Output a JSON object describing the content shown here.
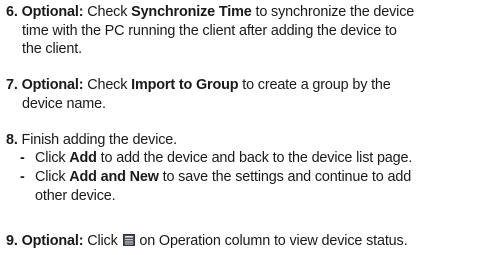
{
  "steps": [
    {
      "number": "6.",
      "prefix": "Optional:",
      "text_a": " Check ",
      "bold": "Synchronize Time",
      "text_b": " to synchronize the device",
      "line2": "time with the PC running the client after adding the device to",
      "line3": "the client."
    },
    {
      "number": "7.",
      "prefix": "Optional:",
      "text_a": " Check ",
      "bold": "Import to Group",
      "text_b": " to create a group by the",
      "line2": "device name."
    },
    {
      "number": "8.",
      "text": " Finish adding the device.",
      "subitems": [
        {
          "dash": "-",
          "text_a": "Click ",
          "bold": "Add",
          "text_b": " to add the device and back to the device list page."
        },
        {
          "dash": "-",
          "text_a": "Click ",
          "bold": "Add and New",
          "text_b": " to save the settings and continue to add",
          "line2": "other device."
        }
      ]
    },
    {
      "number": "9.",
      "prefix": "Optional:",
      "text_a": " Click ",
      "icon": "device-status-icon",
      "text_b": " on Operation column to view device status."
    }
  ]
}
